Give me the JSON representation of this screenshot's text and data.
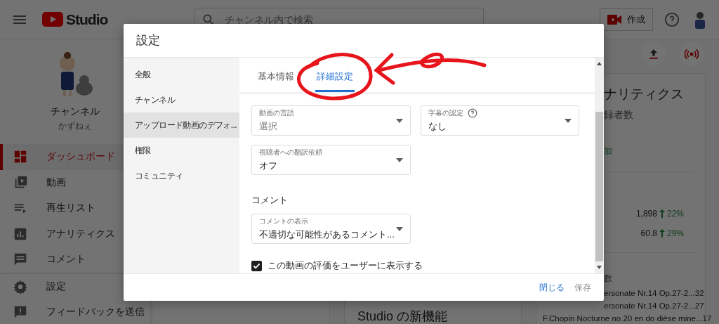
{
  "topbar": {
    "logo": "Studio",
    "search": {
      "placeholder": "チャンネル内で検索"
    },
    "create_button": "作成"
  },
  "sidebar": {
    "channel_title": "チャンネル",
    "channel_name": "かずねぇ",
    "items": [
      {
        "label": "ダッシュボード",
        "selected": true
      },
      {
        "label": "動画",
        "selected": false
      },
      {
        "label": "再生リスト",
        "selected": false
      },
      {
        "label": "アナリティクス",
        "selected": false
      },
      {
        "label": "コメント",
        "selected": false
      }
    ],
    "footer_items": [
      {
        "label": "設定"
      },
      {
        "label": "フィードバックを送信"
      }
    ]
  },
  "dashboard": {
    "middle_card_title": "Studio の新機能",
    "analytics_card": {
      "title": "ナリティクス",
      "subtitle": "録者数",
      "change": "加",
      "metrics": [
        {
          "value": "1,898",
          "change": "22%"
        },
        {
          "value": "60.8",
          "change": "29%"
        }
      ],
      "list_title": "数",
      "videos": [
        {
          "title": "ersonate Nr.14 Op.27-2...",
          "count": "32"
        },
        {
          "title": "ersonate Nr.14 Op.27-2...",
          "count": "27"
        },
        {
          "title": "F.Chopin Nocturne no.20 en do dièse mine...",
          "count": "17"
        }
      ]
    }
  },
  "dialog": {
    "title": "設定",
    "nav": [
      {
        "label": "全般",
        "selected": false
      },
      {
        "label": "チャンネル",
        "selected": false
      },
      {
        "label": "アップロード動画のデフォ...",
        "selected": true
      },
      {
        "label": "権限",
        "selected": false
      },
      {
        "label": "コミュニティ",
        "selected": false
      }
    ],
    "tabs": [
      {
        "label": "基本情報",
        "selected": false
      },
      {
        "label": "詳細設定",
        "selected": true
      }
    ],
    "fields": [
      {
        "label": "動画の言語",
        "placeholder": "選択",
        "help": false
      },
      {
        "label": "字幕の認定",
        "value": "なし",
        "help": true
      },
      {
        "label": "視聴者への翻訳依頼",
        "value": "オフ",
        "help": false
      }
    ],
    "comment_section": {
      "title": "コメント",
      "fields": [
        {
          "label": "コメントの表示",
          "value": "不適切な可能性があるコメント...",
          "help": false
        }
      ]
    },
    "checkbox": {
      "label": "この動画の評価をユーザーに表示する",
      "checked": true
    },
    "buttons": [
      {
        "label": "閉じる",
        "disabled": false
      },
      {
        "label": "保存",
        "disabled": true
      }
    ]
  }
}
